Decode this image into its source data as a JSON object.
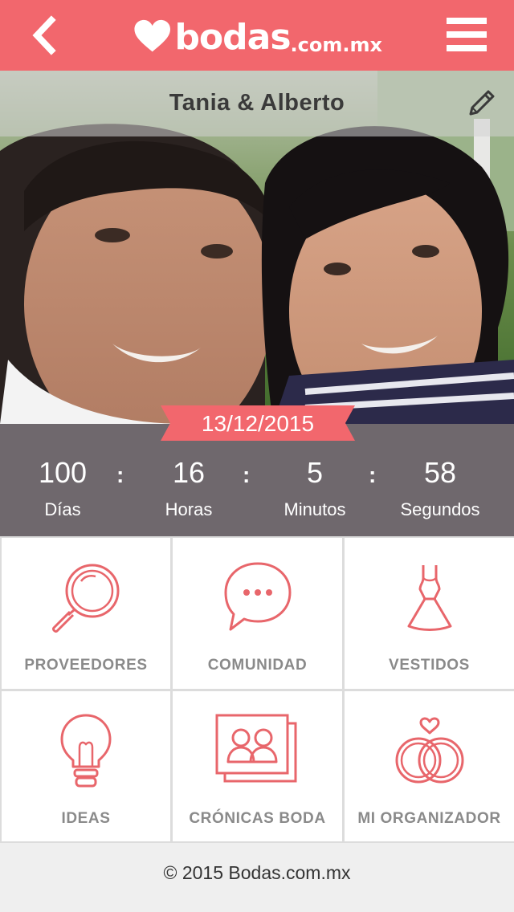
{
  "header": {
    "brand": "bodas",
    "brand_suffix": ".com.mx",
    "back_icon": "chevron-left-icon",
    "menu_icon": "hamburger-menu-icon",
    "color": "#f2676d"
  },
  "hero": {
    "couple_name": "Tania & Alberto",
    "edit_icon": "pencil-icon",
    "wedding_date": "13/12/2015"
  },
  "countdown": {
    "units": [
      {
        "value": "100",
        "label": "Días"
      },
      {
        "value": "16",
        "label": "Horas"
      },
      {
        "value": "5",
        "label": "Minutos"
      },
      {
        "value": "58",
        "label": "Segundos"
      }
    ],
    "separator": ":"
  },
  "menu": {
    "items": [
      {
        "label": "PROVEEDORES",
        "icon": "magnifier-icon"
      },
      {
        "label": "COMUNIDAD",
        "icon": "chat-bubble-icon"
      },
      {
        "label": "VESTIDOS",
        "icon": "dress-icon"
      },
      {
        "label": "IDEAS",
        "icon": "lightbulb-icon"
      },
      {
        "label": "CRÓNICAS BODA",
        "icon": "couple-photos-icon"
      },
      {
        "label": "MI ORGANIZADOR",
        "icon": "wedding-rings-icon"
      }
    ],
    "icon_color": "#e8666b"
  },
  "footer": {
    "copyright": "© 2015 Bodas.com.mx"
  }
}
